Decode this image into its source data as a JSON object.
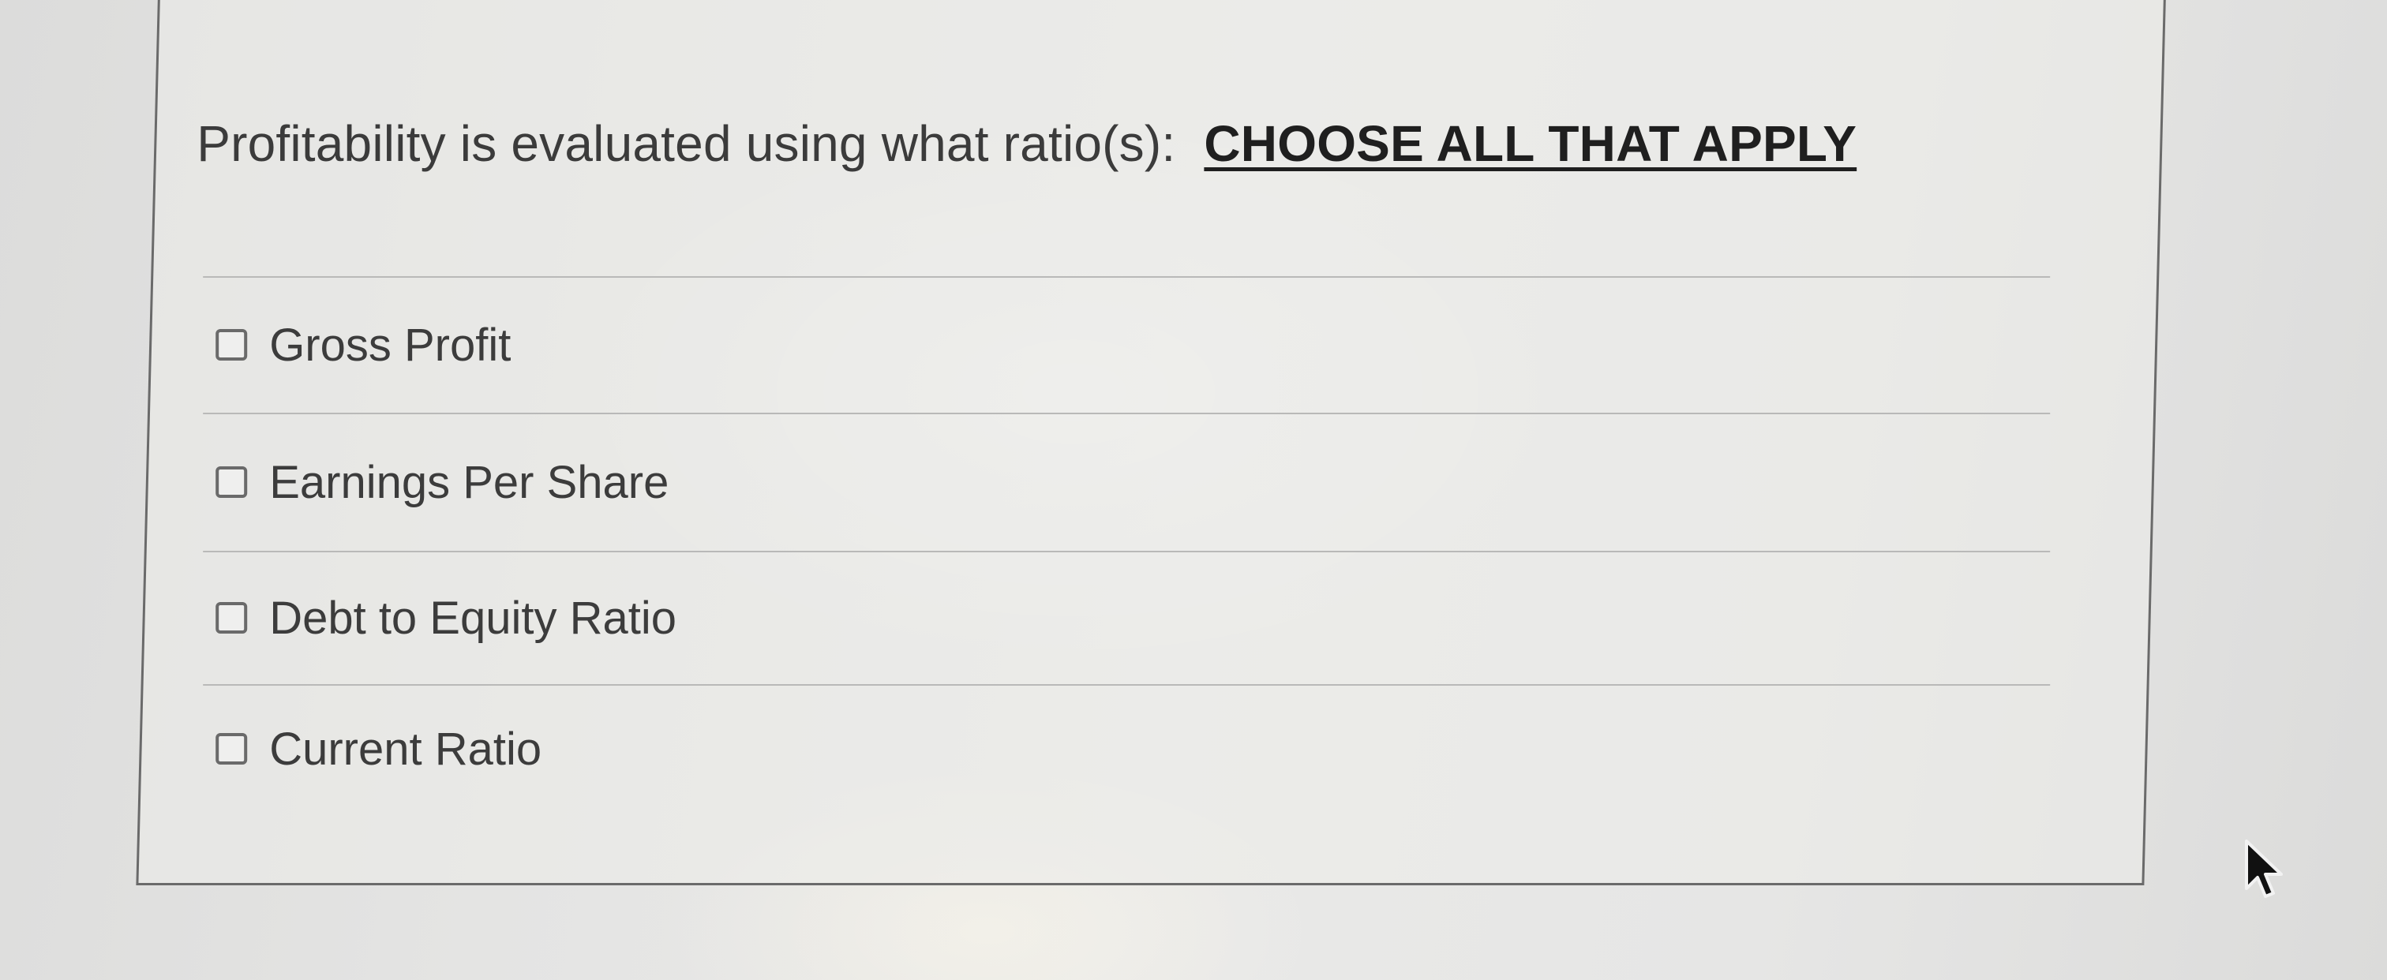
{
  "question": {
    "prompt": "Profitability is evaluated using what ratio(s):",
    "emphasis": "CHOOSE ALL THAT APPLY"
  },
  "options": [
    {
      "label": "Gross Profit",
      "checked": false
    },
    {
      "label": "Earnings Per Share",
      "checked": false
    },
    {
      "label": "Debt to Equity Ratio",
      "checked": false
    },
    {
      "label": "Current Ratio",
      "checked": false
    }
  ],
  "icons": {
    "checkbox": "checkbox-icon",
    "cursor": "mouse-pointer-icon"
  }
}
